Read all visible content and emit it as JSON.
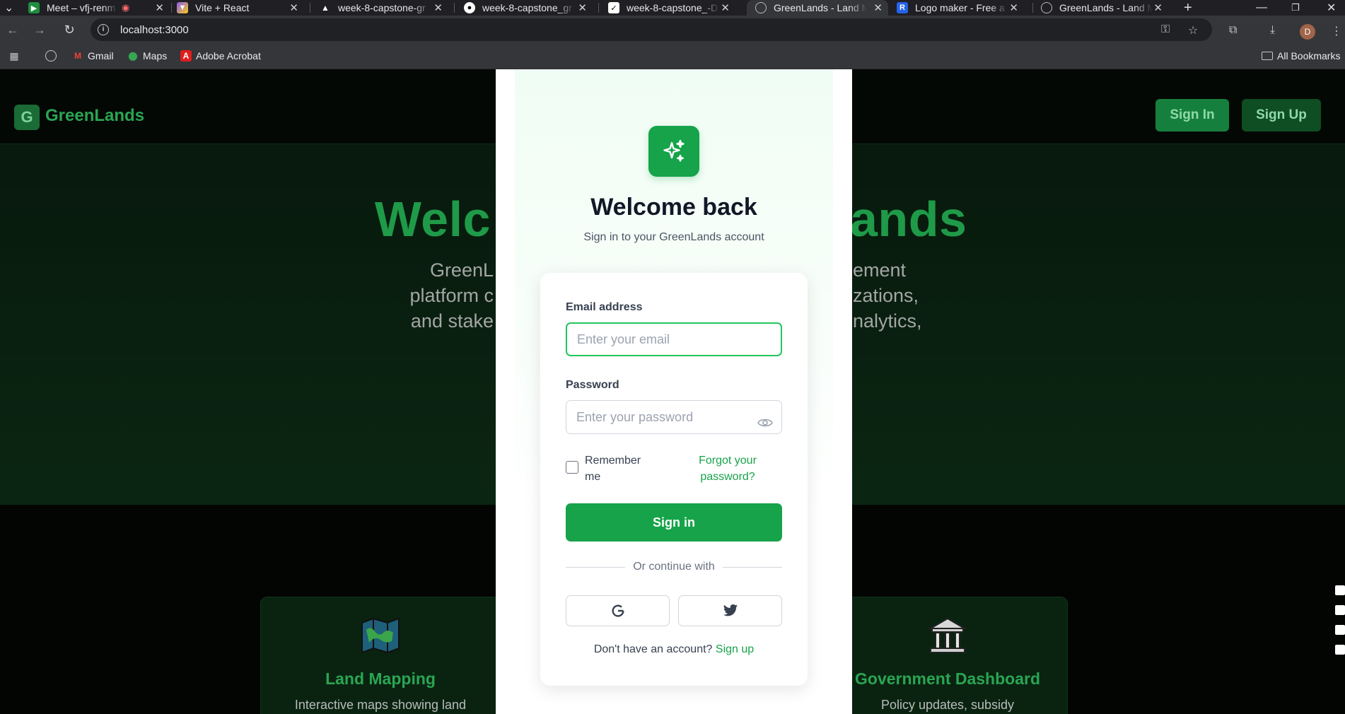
{
  "browser": {
    "tabs": [
      {
        "title": "Meet – vfj-renm",
        "icon": "meet-icon",
        "recording": true
      },
      {
        "title": "Vite + React",
        "icon": "vite-icon"
      },
      {
        "title": "week-8-capstone-gr",
        "icon": "vercel-icon"
      },
      {
        "title": "week-8-capstone_gr",
        "icon": "github-icon"
      },
      {
        "title": "week-8-capstone_-D",
        "icon": "render-icon"
      },
      {
        "title": "GreenLands - Land M",
        "icon": "globe-icon",
        "active": true
      },
      {
        "title": "Logo maker - Free a",
        "icon": "r-icon"
      },
      {
        "title": "GreenLands - Land M",
        "icon": "globe-icon"
      }
    ],
    "url": "localhost:3000",
    "profile_initial": "D",
    "bookmarks": [
      "Gmail",
      "Maps",
      "Adobe Acrobat"
    ],
    "all_bookmarks": "All Bookmarks"
  },
  "header": {
    "logo_letter": "G",
    "brand": "GreenLands",
    "sign_in": "Sign In",
    "sign_up": "Sign Up"
  },
  "hero": {
    "title_left": "Welc",
    "title_right": "ands",
    "desc_lines": [
      [
        "GreenL",
        "ement"
      ],
      [
        "platform c",
        "zations,"
      ],
      [
        "and stake",
        "nalytics,"
      ]
    ]
  },
  "features": [
    {
      "icon": "map-icon",
      "title": "Land Mapping",
      "desc": "Interactive maps showing land"
    },
    {
      "icon": "government-building-icon",
      "title": "Government Dashboard",
      "desc": "Policy updates, subsidy"
    }
  ],
  "modal": {
    "title": "Welcome back",
    "subtitle": "Sign in to your GreenLands account",
    "email_label": "Email address",
    "email_placeholder": "Enter your email",
    "password_label": "Password",
    "password_placeholder": "Enter your password",
    "remember": "Remember me",
    "forgot": "Forgot your password?",
    "submit": "Sign in",
    "divider": "Or continue with",
    "no_account": "Don't have an account?",
    "sign_up_link": "Sign up"
  },
  "colors": {
    "accent": "#16a34a",
    "brand_dark": "#15803d"
  }
}
